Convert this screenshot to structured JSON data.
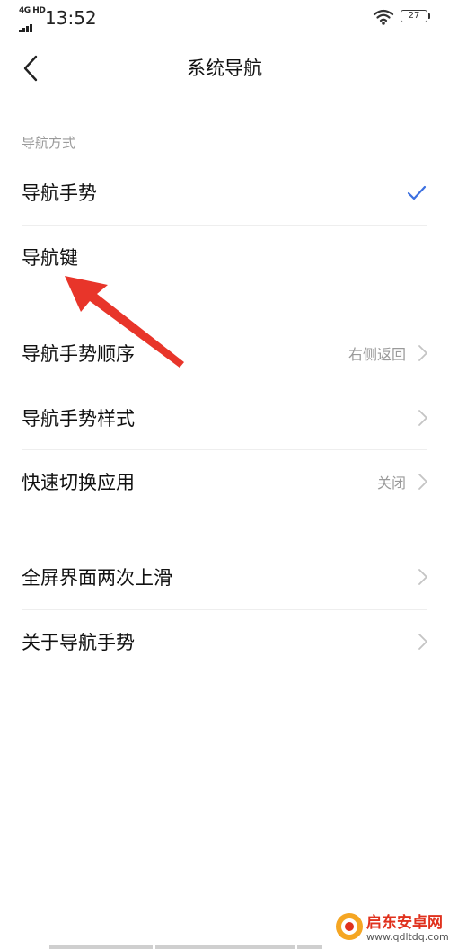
{
  "status_bar": {
    "network": "4G HD",
    "time": "13:52",
    "battery": "27",
    "icons": [
      "signal-icon",
      "wifi-icon",
      "battery-icon"
    ]
  },
  "header": {
    "title": "系统导航",
    "back_icon": "chevron-left-icon"
  },
  "section": {
    "label": "导航方式"
  },
  "nav_modes": [
    {
      "label": "导航手势",
      "selected": true
    },
    {
      "label": "导航键",
      "selected": false
    }
  ],
  "settings": [
    {
      "label": "导航手势顺序",
      "value": "右侧返回"
    },
    {
      "label": "导航手势样式",
      "value": ""
    },
    {
      "label": "快速切换应用",
      "value": "关闭"
    },
    {
      "label": "全屏界面两次上滑",
      "value": ""
    },
    {
      "label": "关于导航手势",
      "value": ""
    }
  ],
  "watermark": {
    "title": "启东安卓网",
    "url": "www.qdltdq.com"
  },
  "colors": {
    "accent": "#3b6fe0",
    "arrow": "#e8352a",
    "secondary_text": "#9a9a9a"
  }
}
